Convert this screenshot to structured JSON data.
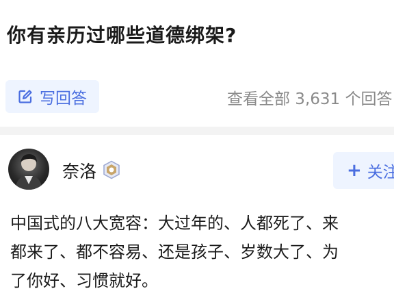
{
  "question": {
    "title": "你有亲历过哪些道德绑架?"
  },
  "actions": {
    "write_answer_label": "写回答",
    "view_all_label": "查看全部 3,631 个回答"
  },
  "answer": {
    "author": {
      "name": "奈洛"
    },
    "follow_label": "关注",
    "content_lines": [
      "中国式的八大宽容：大过年的、人都死了、来",
      "都来了、都不容易、还是孩子、岁数大了、为",
      "了你好、习惯就好。"
    ]
  },
  "icons": {
    "write": "pencil-square-icon",
    "badge": "creator-badge-icon",
    "follow": "plus-icon"
  },
  "colors": {
    "accent": "#4a6ee0",
    "button_bg": "#eef4ff",
    "secondary_text": "#8a8a8a",
    "divider": "#f3f3f3"
  }
}
